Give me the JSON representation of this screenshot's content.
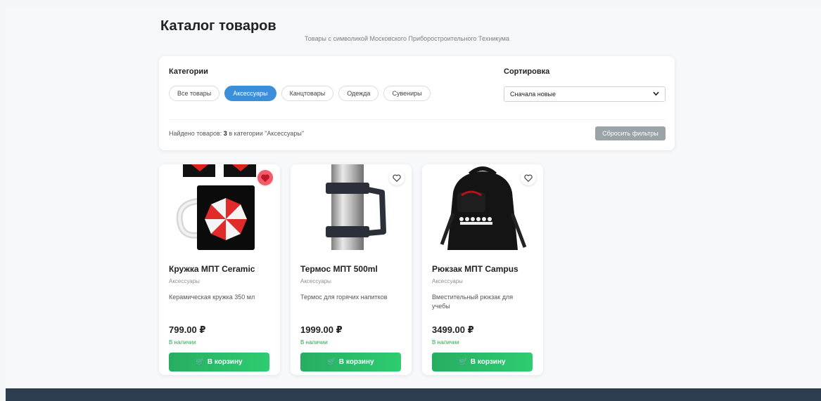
{
  "header": {
    "title": "Каталог товаров",
    "subtitle": "Товары с символикой Московского Приборостроительного Техникума"
  },
  "filters": {
    "categories_label": "Категории",
    "categories": [
      "Все товары",
      "Аксессуары",
      "Канцтовары",
      "Одежда",
      "Сувениры"
    ],
    "active_category": "Аксессуары",
    "sort_label": "Сортировка",
    "sort_value": "Сначала новые",
    "found_prefix": "Найдено товаров:",
    "found_count": "3",
    "found_suffix": "в категории \"Аксессуары\"",
    "reset_label": "Сбросить фильтры"
  },
  "products": [
    {
      "name": "Кружка МПТ Ceramic",
      "category": "Аксессуары",
      "description": "Керамическая кружка 350 мл",
      "price": "799.00 ₽",
      "stock": "В наличии",
      "cart_label": "В корзину",
      "favorited": true
    },
    {
      "name": "Термос МПТ 500ml",
      "category": "Аксессуары",
      "description": "Термос для горячих напитков",
      "price": "1999.00 ₽",
      "stock": "В наличии",
      "cart_label": "В корзину",
      "favorited": false
    },
    {
      "name": "Рюкзак МПТ Campus",
      "category": "Аксессуары",
      "description": "Вместительный рюкзак для учебы",
      "price": "3499.00 ₽",
      "stock": "В наличии",
      "cart_label": "В корзину",
      "favorited": false
    }
  ],
  "colors": {
    "accent": "#3b8fd9",
    "cart": "#2ecc71",
    "favorite": "#f25c6a",
    "footer": "#2c3e50"
  },
  "icons": {
    "favorite": "heart-icon",
    "cart": "cart-icon",
    "sort": "chevron-down-icon"
  }
}
